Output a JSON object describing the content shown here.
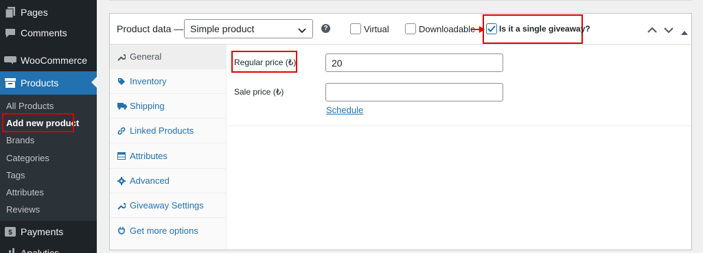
{
  "sidebar": {
    "menu": [
      {
        "label": "Pages",
        "icon": "pages-icon"
      },
      {
        "label": "Comments",
        "icon": "comments-icon"
      },
      {
        "label": "WooCommerce",
        "icon": "woocommerce-icon"
      },
      {
        "label": "Products",
        "icon": "products-icon"
      },
      {
        "label": "Payments",
        "icon": "payments-icon"
      },
      {
        "label": "Analytics",
        "icon": "analytics-icon"
      }
    ],
    "submenu": [
      "All Products",
      "Add new product",
      "Brands",
      "Categories",
      "Tags",
      "Attributes",
      "Reviews"
    ]
  },
  "product_data": {
    "title": "Product data —",
    "type_value": "Simple product",
    "help_glyph": "?",
    "virtual_label": "Virtual",
    "downloadable_label": "Downloadable",
    "giveaway_label": "Is it a single giveaway?",
    "giveaway_checked": true
  },
  "tabs": [
    {
      "label": "General",
      "icon": "wrench-icon",
      "active": true
    },
    {
      "label": "Inventory",
      "icon": "tag-icon"
    },
    {
      "label": "Shipping",
      "icon": "truck-icon"
    },
    {
      "label": "Linked Products",
      "icon": "link-icon"
    },
    {
      "label": "Attributes",
      "icon": "table-icon"
    },
    {
      "label": "Advanced",
      "icon": "gear-icon"
    },
    {
      "label": "Giveaway Settings",
      "icon": "wrench-icon"
    },
    {
      "label": "Get more options",
      "icon": "plugin-icon"
    }
  ],
  "general": {
    "regular_price_label": "Regular price (₺)",
    "regular_price_value": "20",
    "sale_price_label": "Sale price (₺)",
    "sale_price_value": "",
    "schedule_link": "Schedule"
  },
  "colors": {
    "sidebar_bg": "#1d2327",
    "accent": "#2271b1",
    "highlight": "#e00000"
  }
}
